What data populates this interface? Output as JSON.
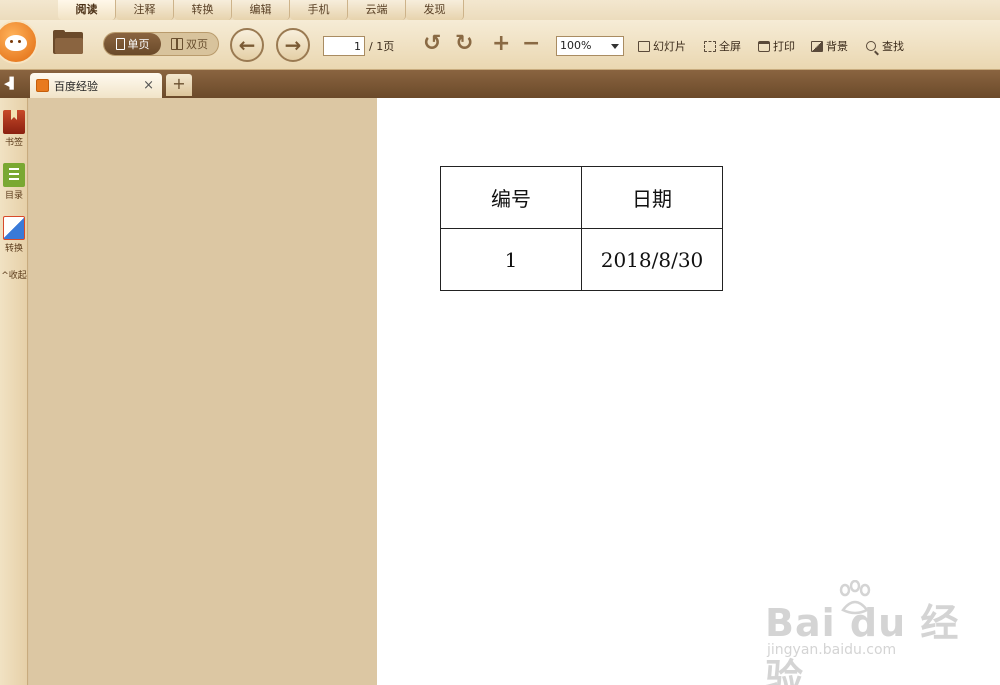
{
  "menu": {
    "tabs": [
      "阅读",
      "注释",
      "转换",
      "编辑",
      "手机",
      "云端",
      "发现"
    ],
    "active_index": 0
  },
  "toolbar": {
    "view_single": "单页",
    "view_double": "双页",
    "page_current": "1",
    "page_total": "/ 1页",
    "zoom": "100%",
    "slideshow": "幻灯片",
    "fullscreen": "全屏",
    "print": "打印",
    "background": "背景",
    "find": "查找"
  },
  "document_tabs": {
    "items": [
      {
        "label": "百度经验"
      }
    ],
    "add": "+"
  },
  "sidebar": {
    "items": [
      {
        "label": "书签",
        "icon": "bookmark-icon"
      },
      {
        "label": "目录",
        "icon": "toc-icon"
      },
      {
        "label": "转换",
        "icon": "convert-icon"
      }
    ],
    "collapse_label": "^收起"
  },
  "document": {
    "table": {
      "headers": [
        "编号",
        "日期"
      ],
      "rows": [
        [
          "1",
          "2018/8/30"
        ]
      ]
    }
  },
  "watermark": {
    "main": "Bai du 经验",
    "sub": "jingyan.baidu.com"
  }
}
